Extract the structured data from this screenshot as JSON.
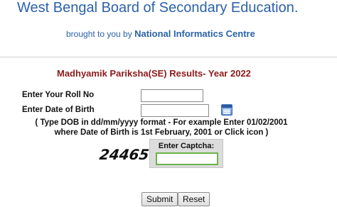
{
  "header": {
    "title": "West Bengal Board of Secondary Education.",
    "byline_prefix": "brought to you by",
    "byline_org": "National Informatics Centre"
  },
  "form": {
    "title": "Madhyamik Pariksha(SE) Results- Year 2022",
    "roll_label": "Enter Your Roll No",
    "roll_value": "",
    "dob_label": "Enter Date of Birth",
    "dob_value": "",
    "dob_hint": "( Type DOB in dd/mm/yyyy format - For example Enter 01/02/2001 where Date of Birth is 1st February, 2001 or Click icon   )",
    "calendar_icon": "calendar-icon",
    "captcha_text": "24465",
    "captcha_label": "Enter Captcha:",
    "captcha_value": "",
    "submit_label": "Submit",
    "reset_label": "Reset"
  },
  "colors": {
    "header_blue": "#2b62a8",
    "title_maroon": "#8b1a1a",
    "captcha_focus_green": "#69b54a"
  }
}
